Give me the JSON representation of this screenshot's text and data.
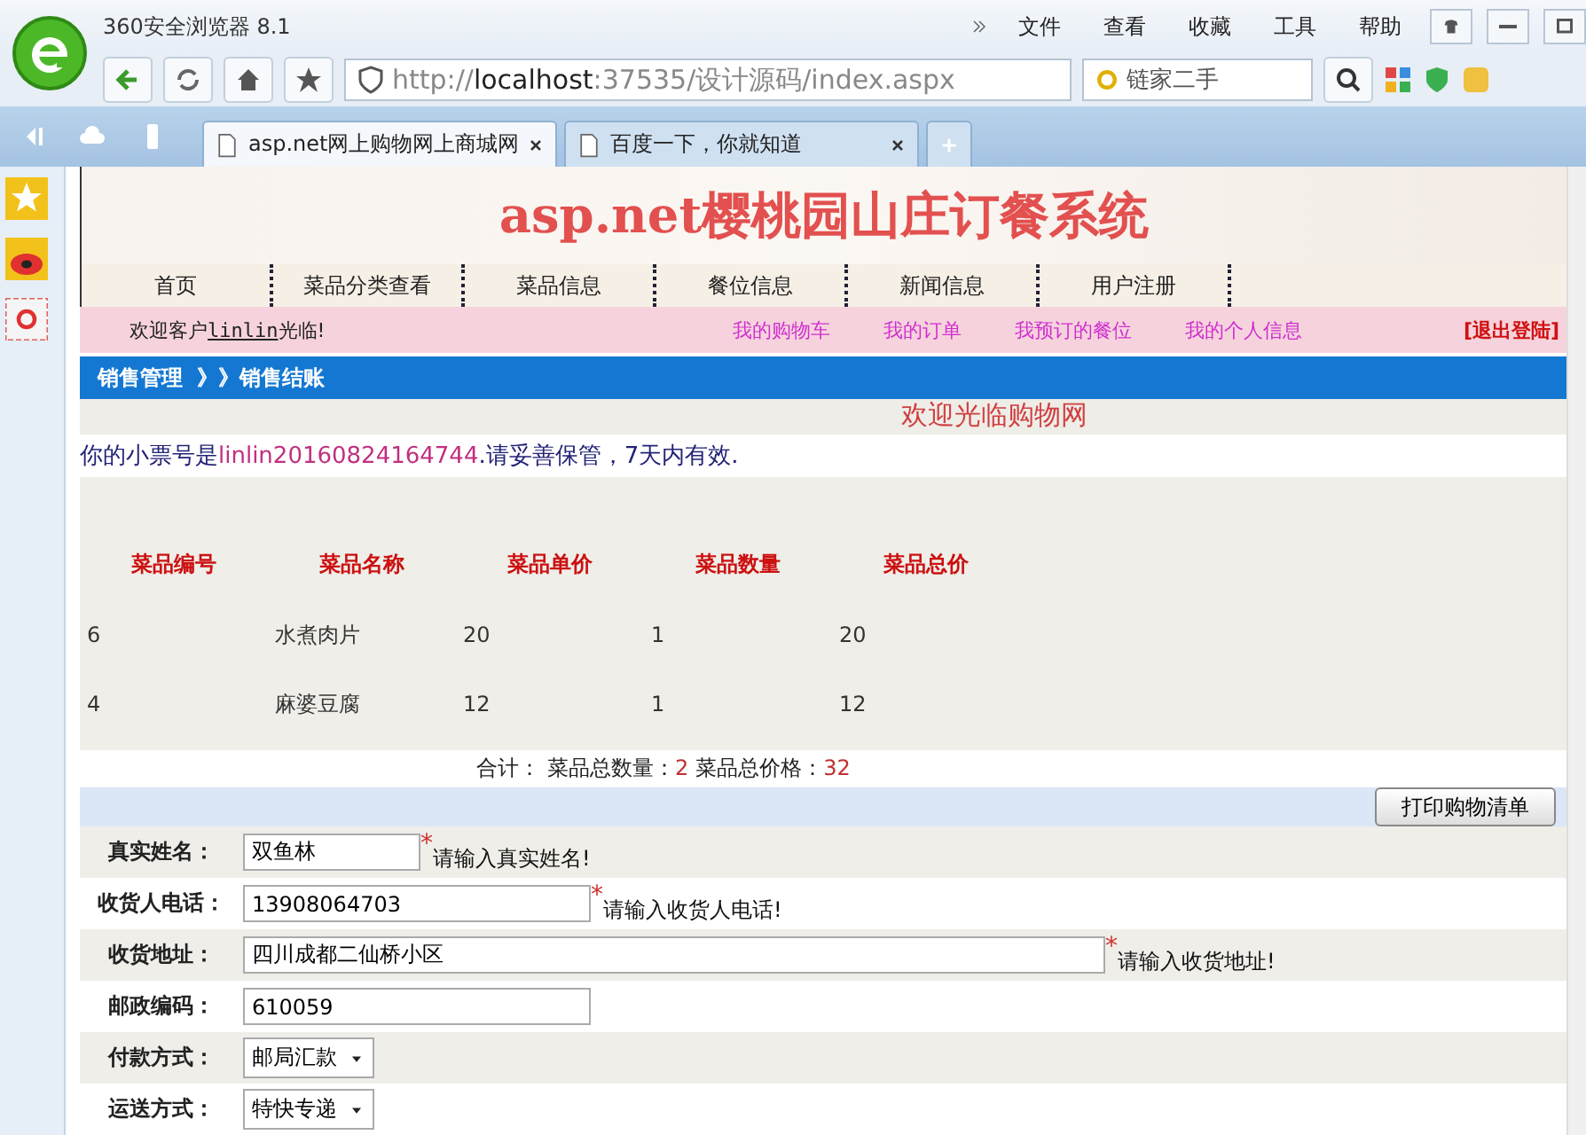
{
  "browser": {
    "title": "360安全浏览器 8.1",
    "menu": [
      "文件",
      "查看",
      "收藏",
      "工具",
      "帮助"
    ],
    "address": {
      "scheme": "http://",
      "host": "localhost",
      "rest": ":37535/设计源码/index.aspx"
    },
    "search": {
      "value": "链家二手"
    },
    "tabs": [
      {
        "label": "asp.net网上购物网上商城网",
        "selected": true
      },
      {
        "label": "百度一下，你就知道",
        "selected": false
      }
    ]
  },
  "site": {
    "title": "asp.net樱桃园山庄订餐系统",
    "nav": [
      "首页",
      "菜品分类查看",
      "菜品信息",
      "餐位信息",
      "新闻信息",
      "用户注册"
    ],
    "welcome": {
      "prefix": "欢迎客户",
      "user": "linlin",
      "suffix": "光临!"
    },
    "user_links": [
      "我的购物车",
      "我的订单",
      "我预订的餐位",
      "我的个人信息"
    ],
    "logout": "[退出登陆]",
    "breadcrumb": [
      "销售管理",
      "》》销售结账"
    ]
  },
  "page": {
    "heading": "欢迎光临购物网",
    "notice": {
      "before": "你的小票号是",
      "ticket": "linlin20160824164744",
      "after": ".请妥善保管，7天内有效."
    },
    "table": {
      "columns": [
        "菜品编号",
        "菜品名称",
        "菜品单价",
        "菜品数量",
        "菜品总价"
      ],
      "rows": [
        [
          "6",
          "水煮肉片",
          "20",
          "1",
          "20"
        ],
        [
          "4",
          "麻婆豆腐",
          "12",
          "1",
          "12"
        ]
      ]
    },
    "summary": {
      "label": "合计：",
      "count_label": "菜品总数量：",
      "count": "2",
      "price_label": "菜品总价格：",
      "price": "32"
    },
    "print_button": "打印购物清单",
    "form": [
      {
        "kind": "text",
        "label": "真实姓名：",
        "value": "双鱼林",
        "mark": "*",
        "hint": "请输入真实姓名!"
      },
      {
        "kind": "medium_text",
        "label": "收货人电话：",
        "value": "13908064703",
        "mark": "*",
        "hint": "请输入收货人电话!"
      },
      {
        "kind": "wide_text",
        "label": "收货地址：",
        "value": "四川成都二仙桥小区",
        "mark": "*",
        "hint": "请输入收货地址!"
      },
      {
        "kind": "medium_text",
        "label": "邮政编码：",
        "value": "610059"
      },
      {
        "kind": "select",
        "label": "付款方式：",
        "value": "邮局汇款"
      },
      {
        "kind": "select",
        "label": "运送方式：",
        "value": "特快专递"
      }
    ]
  }
}
